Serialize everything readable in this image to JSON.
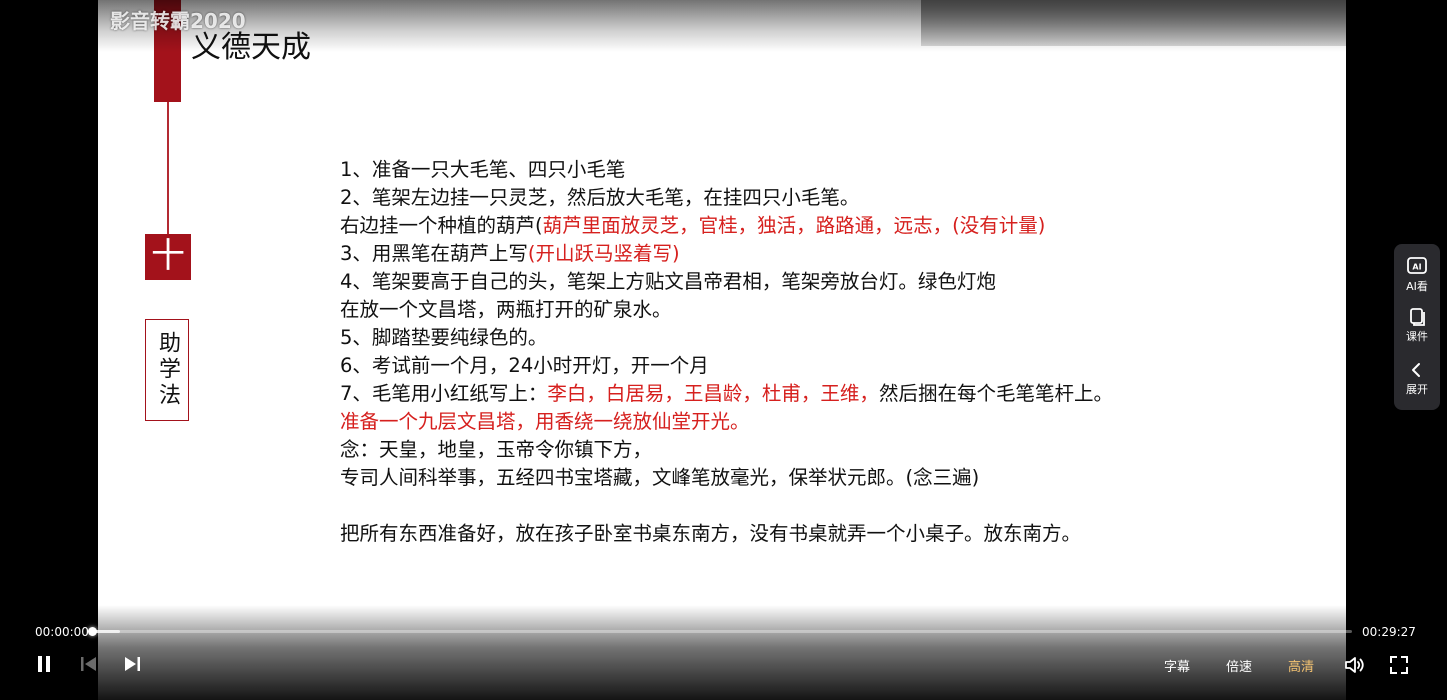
{
  "video": {
    "watermark": "影音转霸2020",
    "slide": {
      "title": "义德天成",
      "plus_symbol": "十",
      "side_label": "助学法",
      "lines": [
        {
          "segments": [
            {
              "text": "1、准备一只大毛笔、四只小毛笔",
              "red": false
            }
          ]
        },
        {
          "segments": [
            {
              "text": "2、笔架左边挂一只灵芝，然后放大毛笔，在挂四只小毛笔。",
              "red": false
            }
          ]
        },
        {
          "segments": [
            {
              "text": "右边挂一个种植的葫芦(",
              "red": false
            },
            {
              "text": "葫芦里面放灵芝，官桂，独活，路路通，远志，(没有计量)",
              "red": true
            }
          ]
        },
        {
          "segments": [
            {
              "text": "3、用黑笔在葫芦上写",
              "red": false
            },
            {
              "text": "(开山跃马竖着写)",
              "red": true
            }
          ]
        },
        {
          "segments": [
            {
              "text": "4、笔架要高于自己的头，笔架上方贴文昌帝君相，笔架旁放台灯。绿色灯炮",
              "red": false
            }
          ]
        },
        {
          "segments": [
            {
              "text": "在放一个文昌塔，两瓶打开的矿泉水。",
              "red": false
            }
          ]
        },
        {
          "segments": [
            {
              "text": "5、脚踏垫要纯绿色的。",
              "red": false
            }
          ]
        },
        {
          "segments": [
            {
              "text": "6、考试前一个月，24小时开灯，开一个月",
              "red": false
            }
          ]
        },
        {
          "segments": [
            {
              "text": "7、毛笔用小红纸写上：",
              "red": false
            },
            {
              "text": "李白，白居易，王昌龄，杜甫，王维，",
              "red": true
            },
            {
              "text": "然后捆在每个毛笔笔杆上。",
              "red": false
            }
          ]
        },
        {
          "segments": [
            {
              "text": "准备一个九层文昌塔，用香绕一绕放仙堂开光。",
              "red": true
            }
          ]
        },
        {
          "segments": [
            {
              "text": "念：天皇，地皇，玉帝令你镇下方，",
              "red": false
            }
          ]
        },
        {
          "segments": [
            {
              "text": "专司人间科举事，五经四书宝塔藏，文峰笔放毫光，保举状元郎。(念三遍)",
              "red": false
            }
          ]
        },
        {
          "segments": []
        },
        {
          "segments": [
            {
              "text": "把所有东西准备好，放在孩子卧室书桌东南方，没有书桌就弄一个小桌子。放东南方。",
              "red": false
            }
          ]
        }
      ]
    },
    "colors": {
      "accent_red": "#a3121b",
      "text_red": "#d6201e",
      "hd_gold": "#f3c271"
    }
  },
  "controls": {
    "current_time": "00:00:00",
    "duration": "00:29:27",
    "progress_fraction": 0.0,
    "buttons": {
      "pause": "pause-icon",
      "prev": "skip-previous-icon",
      "next": "skip-next-icon",
      "volume": "volume-icon",
      "fullscreen": "fullscreen-icon"
    },
    "subtitle_label": "字幕",
    "speed_label": "倍速",
    "quality_label": "高清"
  },
  "side_panel": {
    "items": [
      {
        "label": "AI看",
        "icon": "ai-view-icon"
      },
      {
        "label": "课件",
        "icon": "courseware-icon"
      },
      {
        "label": "展开",
        "icon": "chevron-left-icon"
      }
    ]
  }
}
